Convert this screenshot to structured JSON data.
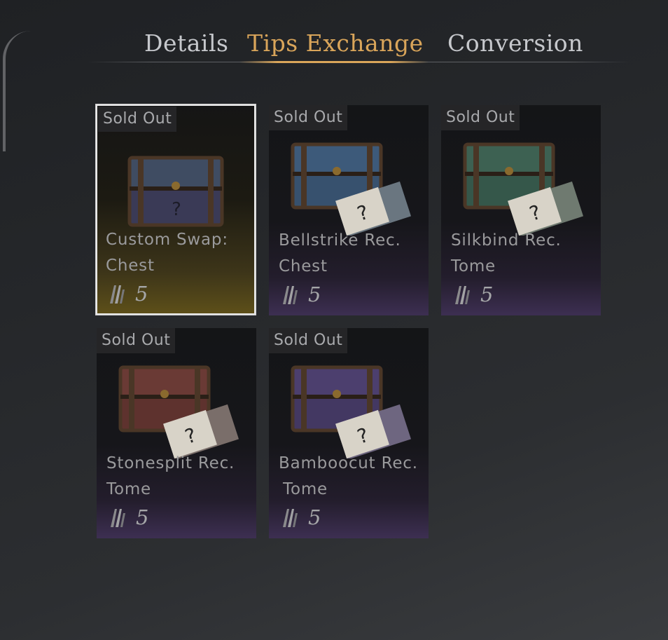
{
  "tabs": {
    "details": "Details",
    "tips_exchange": "Tips Exchange",
    "conversion": "Conversion",
    "active": "Tips Exchange"
  },
  "colors": {
    "active_tab": "#d9a55a",
    "inactive_tab": "#c6c8cc",
    "selected_border": "#e8e8e8"
  },
  "items": [
    {
      "badge": "Sold Out",
      "name_line1": "Custom Swap:",
      "name_line2": "Chest",
      "cost": "5",
      "lid_color": "#3f4c62",
      "body_color": "#3a3a56",
      "selected": true
    },
    {
      "badge": "Sold Out",
      "name_line1": "Bellstrike Rec.",
      "name_line2": "Chest",
      "cost": "5",
      "lid_color": "#3d5a7a",
      "body_color": "#37516e",
      "selected": false
    },
    {
      "badge": "Sold Out",
      "name_line1": "Silkbind Rec.",
      "name_line2": "Tome",
      "cost": "5",
      "lid_color": "#3d6152",
      "body_color": "#35574a",
      "selected": false
    },
    {
      "badge": "Sold Out",
      "name_line1": "Stonesplit Rec.",
      "name_line2": "Tome",
      "cost": "5",
      "lid_color": "#6a3a35",
      "body_color": "#5e322e",
      "selected": false
    },
    {
      "badge": "Sold Out",
      "name_line1": "Bamboocut Rec.",
      "name_line2": "Tome",
      "cost": "5",
      "lid_color": "#4c3f6e",
      "body_color": "#433862",
      "selected": false
    }
  ]
}
